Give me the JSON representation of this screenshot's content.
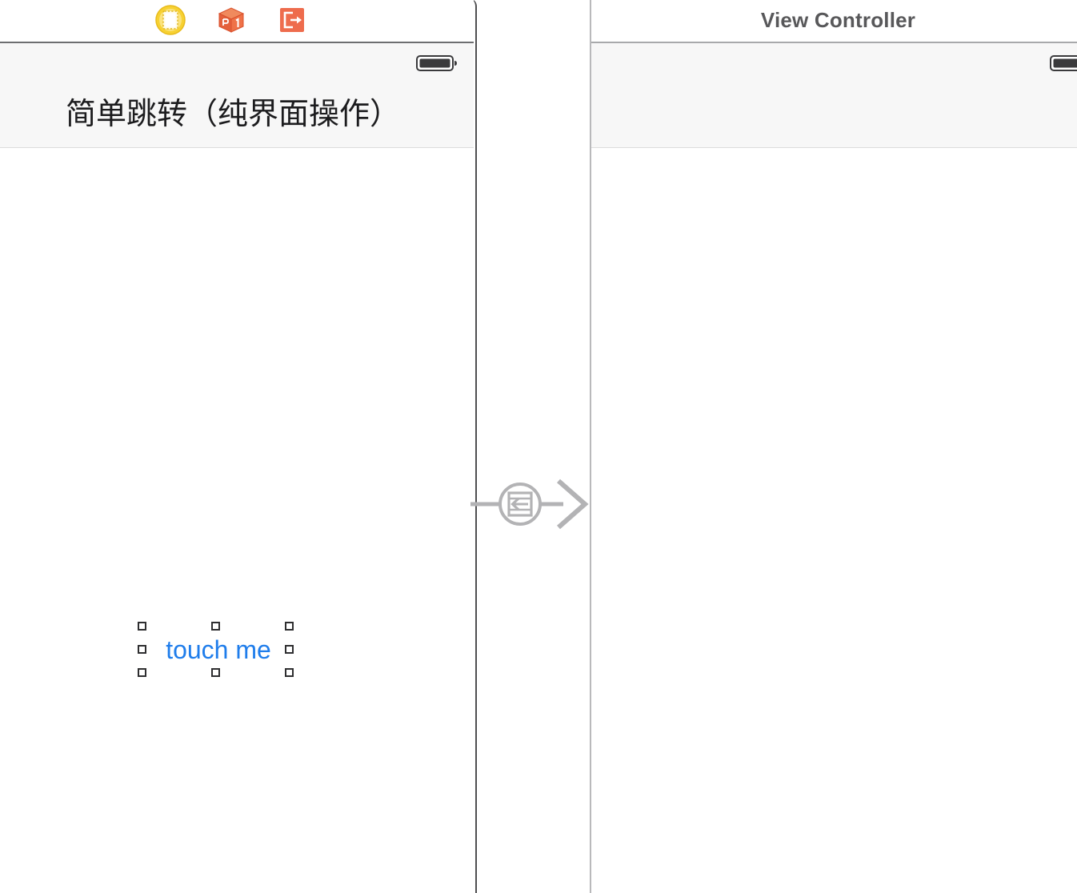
{
  "editor": {
    "background_color": "#ffffff",
    "selection_handle_color": "#2e2e30"
  },
  "left_scene": {
    "name": "simple-jump-view-controller-scene",
    "dock": {
      "items": [
        {
          "icon": "view-controller-icon",
          "label": "View Controller",
          "color": "#f5c521"
        },
        {
          "icon": "first-responder-cube-icon",
          "label": "First Responder",
          "color": "#ef6f45"
        },
        {
          "icon": "exit-icon",
          "label": "Exit",
          "color": "#ee6c4d"
        }
      ]
    },
    "status_bar": {
      "battery_icon": "battery-full-icon"
    },
    "navigation_bar": {
      "title": "简单跳转（纯界面操作）"
    },
    "content": {
      "button": {
        "label": "touch me",
        "text_color": "#1f7deb",
        "selected": true,
        "handle_count": 8
      }
    }
  },
  "segue": {
    "name": "show-segue-connector",
    "kind": "show",
    "icon": "segue-show-icon",
    "arrow_icon": "chevron-right-arrow-icon",
    "color": "#b3b3b5"
  },
  "right_scene": {
    "name": "view-controller-scene",
    "title": "View Controller",
    "status_bar": {
      "battery_icon": "battery-full-icon"
    },
    "navigation_bar": {
      "title": ""
    }
  }
}
